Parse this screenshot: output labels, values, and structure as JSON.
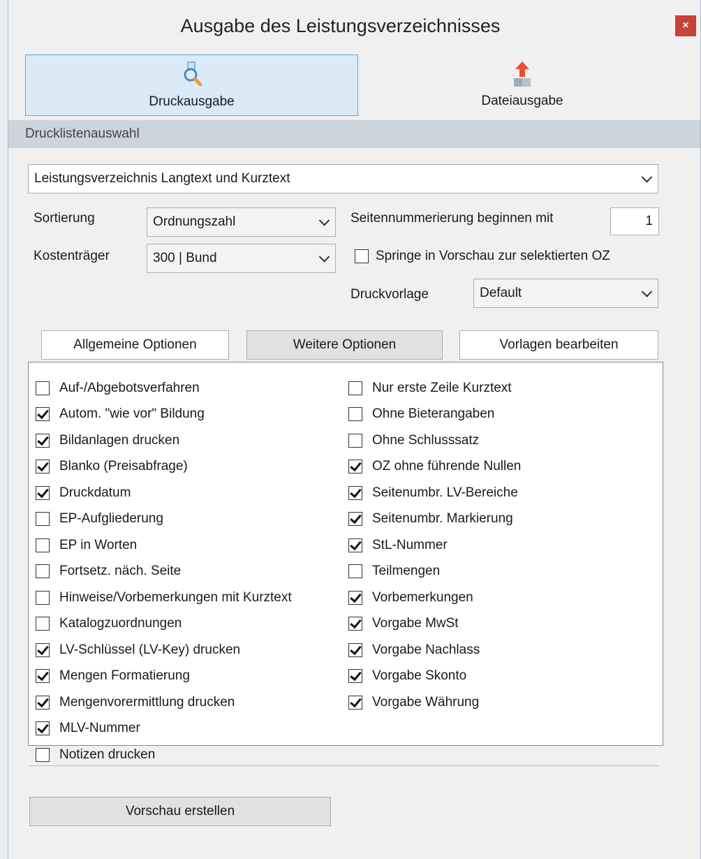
{
  "window": {
    "title": "Ausgabe des Leistungsverzeichnisses",
    "close_glyph": "×"
  },
  "modes": [
    {
      "label": "Druckausgabe",
      "icon": "print-preview-icon",
      "active": true
    },
    {
      "label": "Dateiausgabe",
      "icon": "file-export-icon",
      "active": false
    }
  ],
  "section": {
    "title": "Drucklistenauswahl"
  },
  "list_select": {
    "value": "Leistungsverzeichnis Langtext und Kurztext"
  },
  "sorting": {
    "label": "Sortierung",
    "value": "Ordnungszahl"
  },
  "cost_unit": {
    "label": "Kostenträger",
    "value": "300 | Bund"
  },
  "page_numbering": {
    "label": "Seitennummerierung beginnen mit",
    "value": "1"
  },
  "jump_preview": {
    "label": "Springe in Vorschau zur selektierten OZ",
    "checked": false
  },
  "template": {
    "label": "Druckvorlage",
    "value": "Default"
  },
  "tabs": [
    {
      "label": "Allgemeine Optionen",
      "selected": false
    },
    {
      "label": "Weitere Optionen",
      "selected": true
    },
    {
      "label": "Vorlagen bearbeiten",
      "selected": false
    }
  ],
  "options_left": [
    {
      "label": "Auf-/Abgebotsverfahren",
      "checked": false
    },
    {
      "label": "Autom. \"wie vor\" Bildung",
      "checked": true
    },
    {
      "label": "Bildanlagen drucken",
      "checked": true
    },
    {
      "label": "Blanko (Preisabfrage)",
      "checked": true
    },
    {
      "label": "Druckdatum",
      "checked": true
    },
    {
      "label": "EP-Aufgliederung",
      "checked": false
    },
    {
      "label": "EP in Worten",
      "checked": false
    },
    {
      "label": "Fortsetz. näch. Seite",
      "checked": false
    },
    {
      "label": "Hinweise/Vorbemerkungen mit Kurztext",
      "checked": false
    },
    {
      "label": "Katalogzuordnungen",
      "checked": false
    },
    {
      "label": "LV-Schlüssel (LV-Key) drucken",
      "checked": true
    },
    {
      "label": "Mengen Formatierung",
      "checked": true
    },
    {
      "label": "Mengenvorermittlung drucken",
      "checked": true
    },
    {
      "label": "MLV-Nummer",
      "checked": true
    },
    {
      "label": "Notizen drucken",
      "checked": false
    }
  ],
  "options_right": [
    {
      "label": "Nur erste Zeile Kurztext",
      "checked": false
    },
    {
      "label": "Ohne Bieterangaben",
      "checked": false
    },
    {
      "label": "Ohne Schlusssatz",
      "checked": false
    },
    {
      "label": "OZ ohne führende Nullen",
      "checked": true
    },
    {
      "label": "Seitenumbr. LV-Bereiche",
      "checked": true
    },
    {
      "label": "Seitenumbr. Markierung",
      "checked": true
    },
    {
      "label": "StL-Nummer",
      "checked": true
    },
    {
      "label": "Teilmengen",
      "checked": false
    },
    {
      "label": "Vorbemerkungen",
      "checked": true
    },
    {
      "label": "Vorgabe MwSt",
      "checked": true
    },
    {
      "label": "Vorgabe Nachlass",
      "checked": true
    },
    {
      "label": "Vorgabe Skonto",
      "checked": true
    },
    {
      "label": "Vorgabe Währung",
      "checked": true
    }
  ],
  "preview_button": {
    "label": "Vorschau erstellen"
  },
  "colors": {
    "accent": "#5aa6dd",
    "active_tab_bg": "#daeaf7",
    "close_bg": "#c8413a",
    "export_arrow": "#e8502c"
  }
}
